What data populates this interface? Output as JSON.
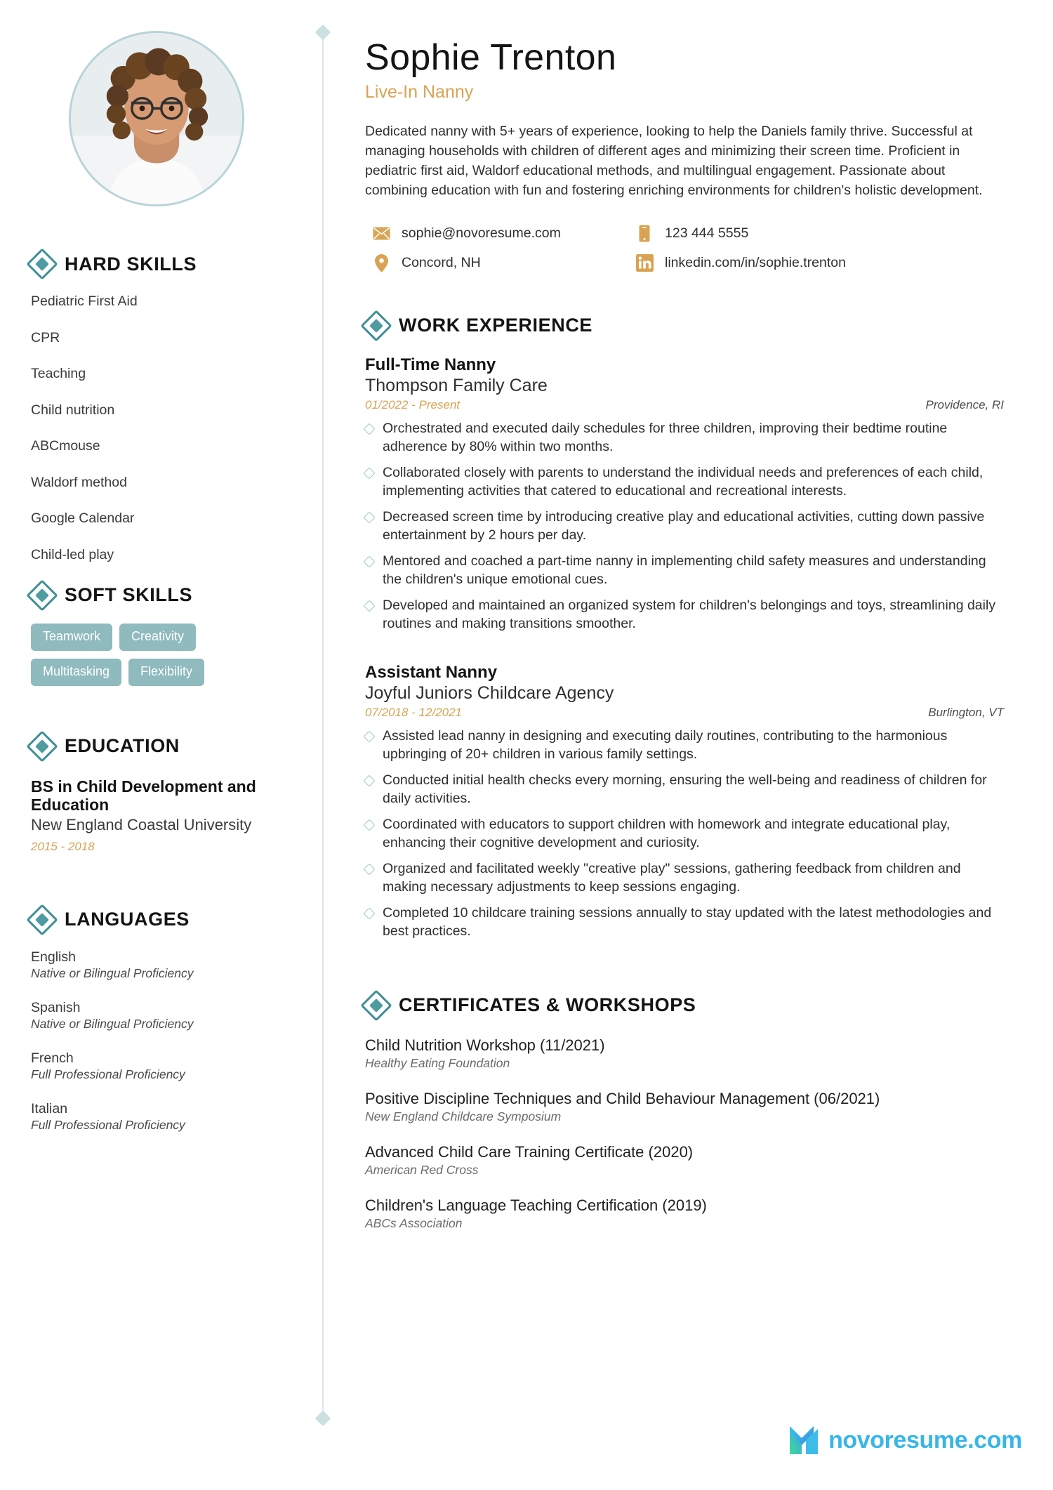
{
  "header": {
    "name": "Sophie Trenton",
    "role": "Live-In Nanny",
    "summary": "Dedicated nanny with 5+ years of experience, looking to help the Daniels family thrive. Successful at managing households with children of different ages and minimizing their screen time. Proficient in pediatric first aid, Waldorf educational methods, and multilingual engagement. Passionate about combining education with fun and fostering enriching environments for children's holistic development."
  },
  "contacts": [
    {
      "icon": "email-icon",
      "value": "sophie@novoresume.com"
    },
    {
      "icon": "phone-icon",
      "value": "123 444 5555"
    },
    {
      "icon": "location-pin-icon",
      "value": "Concord, NH"
    },
    {
      "icon": "linkedin-icon",
      "value": "linkedin.com/in/sophie.trenton"
    }
  ],
  "sidebar": {
    "hard_skills": {
      "title": "HARD SKILLS",
      "items": [
        "Pediatric First Aid",
        "CPR",
        "Teaching",
        "Child nutrition",
        "ABCmouse",
        "Waldorf method",
        "Google Calendar",
        "Child-led play"
      ]
    },
    "soft_skills": {
      "title": "SOFT SKILLS",
      "rows": [
        [
          "Teamwork",
          "Creativity"
        ],
        [
          "Multitasking",
          "Flexibility"
        ]
      ]
    },
    "education": {
      "title": "EDUCATION",
      "entries": [
        {
          "degree": "BS in Child Development and Education",
          "school": "New England Coastal University",
          "dates": "2015 - 2018"
        }
      ]
    },
    "languages": {
      "title": "LANGUAGES",
      "items": [
        {
          "name": "English",
          "level": "Native or Bilingual Proficiency"
        },
        {
          "name": "Spanish",
          "level": "Native or Bilingual Proficiency"
        },
        {
          "name": "French",
          "level": "Full Professional Proficiency"
        },
        {
          "name": "Italian",
          "level": "Full Professional Proficiency"
        }
      ]
    }
  },
  "work": {
    "title": "WORK EXPERIENCE",
    "jobs": [
      {
        "title": "Full-Time Nanny",
        "company": "Thompson Family Care",
        "dates": "01/2022 - Present",
        "location": "Providence, RI",
        "bullets": [
          "Orchestrated and executed daily schedules for three children, improving their bedtime routine adherence by 80% within two months.",
          "Collaborated closely with parents to understand the individual needs and preferences of each child, implementing activities that catered to educational and recreational interests.",
          "Decreased screen time by introducing creative play and educational activities, cutting down passive entertainment by 2 hours per day.",
          "Mentored and coached a part-time nanny in implementing child safety measures and understanding the children's unique emotional cues.",
          "Developed and maintained an organized system for children's belongings and toys, streamlining daily routines and making transitions smoother."
        ]
      },
      {
        "title": "Assistant Nanny",
        "company": "Joyful Juniors Childcare Agency",
        "dates": "07/2018 - 12/2021",
        "location": "Burlington, VT",
        "bullets": [
          "Assisted lead nanny in designing and executing daily routines, contributing to the harmonious upbringing of 20+ children in various family settings.",
          "Conducted initial health checks every morning, ensuring the well-being and readiness of children for daily activities.",
          "Coordinated with educators to support children with homework and integrate educational play, enhancing their cognitive development and curiosity.",
          "Organized and facilitated weekly \"creative play\" sessions, gathering feedback from children and making necessary adjustments to keep sessions engaging.",
          "Completed 10 childcare training sessions annually to stay updated with the latest methodologies and best practices."
        ]
      }
    ]
  },
  "certificates": {
    "title": "CERTIFICATES & WORKSHOPS",
    "items": [
      {
        "name": "Child Nutrition Workshop (11/2021)",
        "org": "Healthy Eating Foundation"
      },
      {
        "name": "Positive Discipline Techniques and Child Behaviour Management (06/2021)",
        "org": "New England Childcare Symposium"
      },
      {
        "name": "Advanced Child Care Training Certificate (2020)",
        "org": "American Red Cross"
      },
      {
        "name": "Children's Language Teaching Certification (2019)",
        "org": "ABCs Association"
      }
    ]
  },
  "footer": {
    "logo_text": "novoresume.com"
  },
  "colors": {
    "accent_teal": "#4e9ba1",
    "accent_gold": "#d9a353",
    "pill_bg": "#8fbabe",
    "divider": "#d9e7e8",
    "logo_blue": "#38b6e8"
  }
}
